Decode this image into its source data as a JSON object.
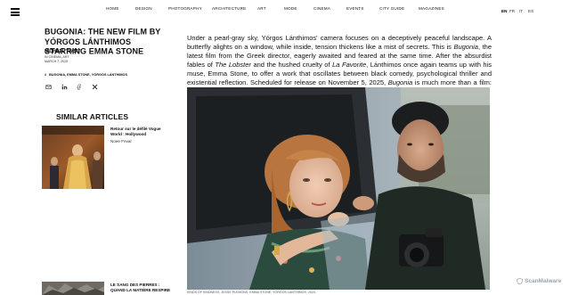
{
  "nav": {
    "items": [
      "HOME",
      "DESIGN",
      "PHOTOGRAPHY",
      "ARCHITECTURE",
      "ART",
      "MODE",
      "CINEMA",
      "EVENTS",
      "CITY GUIDE",
      "MAGAZINES"
    ],
    "languages": [
      "EN",
      "FR",
      "IT",
      "ES"
    ],
    "active_language": "EN"
  },
  "article": {
    "title": "BUGONIA: THE NEW FILM BY YÓRGOS LÁNTHIMOS STARRING EMMA STONE",
    "author": "MICHAEL TIMSIT",
    "section": "IN CINEMA, ART",
    "date": "MARCH 7, 2025",
    "tags": "BUGONIA, EMMA STONE, YÓRGOS LÁNTHIMOS",
    "body_1": "Under a pearl-gray sky, Yórgos Lánthimos' camera focuses on a deceptively peaceful landscape. A butterfly alights on a window, while inside, tension thickens like a mist of secrets. This is ",
    "body_2": "Bugonia",
    "body_3": ", the latest film from the Greek director, eagerly awaited and feared at the same time. After the absurdist fables of ",
    "body_4": "The Lobster",
    "body_5": " and the hushed cruelty of ",
    "body_6": "La Favorite",
    "body_7": ", Lánthimos once again teams up with his muse, Emma Stone, to offer a work that oscillates between black comedy, psychological thriller and existential reflection. Scheduled for release on November 5, 2025, ",
    "body_8": "Bugonia",
    "body_9": " is much more than a film: it's a labyrinth where logic crumbles, laughter becomes unease and reality itself seems to waver.",
    "caption": "KINDS OF KINDNESS, Jesse Plemons, Emma Stone, Yorgos Lanthimos, 2024."
  },
  "similar": {
    "heading": "SIMILAR ARTICLES",
    "items": [
      {
        "title": "Retour sur le défilé Vogue World : Hollywood",
        "author": "Noee Feval"
      },
      {
        "title": "LE SANG DES PIERRES : QUAND LA MATIÈRE RESPIRE",
        "author": ""
      }
    ]
  },
  "watermark": "ScanMalware",
  "icons": [
    "menu-icon",
    "email-icon",
    "linkedin-icon",
    "facebook-icon",
    "x-icon"
  ],
  "colors": {
    "text": "#111111",
    "background": "#ffffff"
  }
}
